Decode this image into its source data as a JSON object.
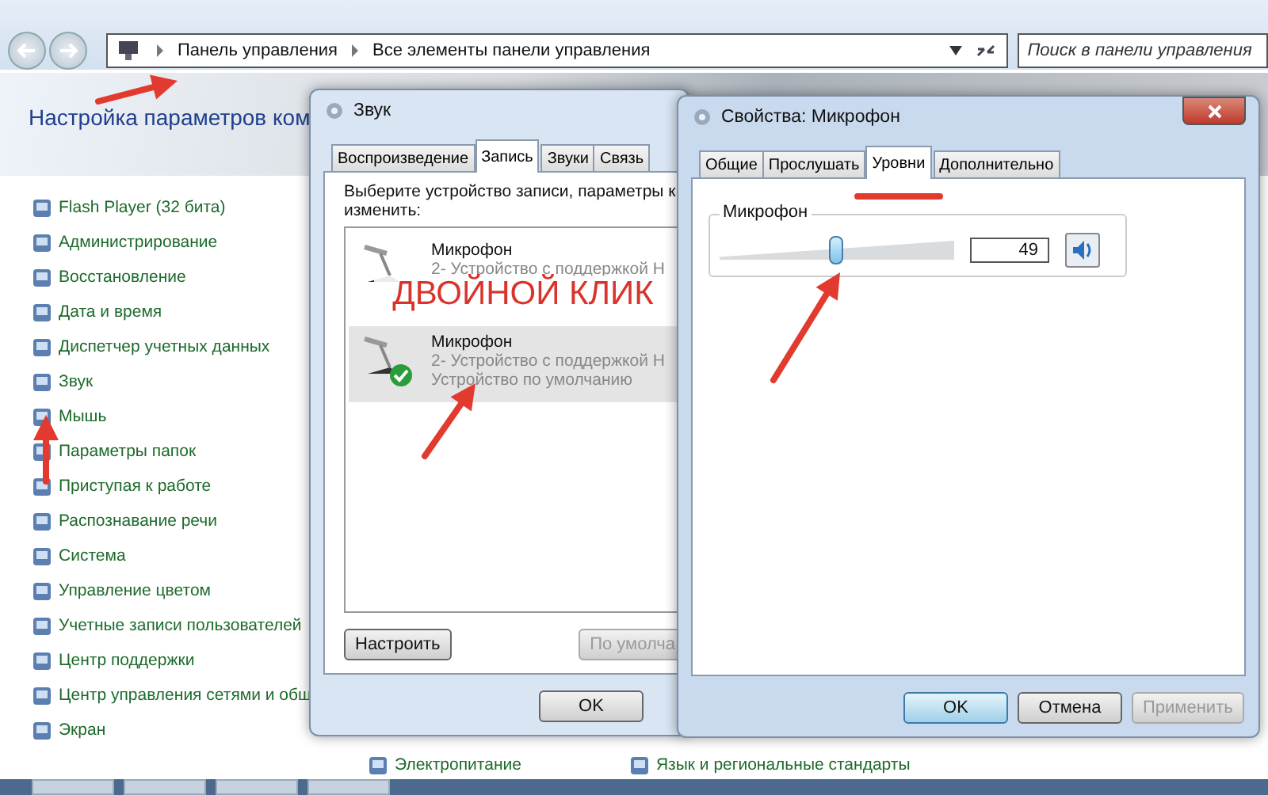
{
  "explorer": {
    "nav_path": [
      "Панель управления",
      "Все элементы панели управления"
    ],
    "search": {
      "placeholder": "Поиск в панели управления"
    },
    "heading": "Настройка параметров ком",
    "items": [
      "Flash Player (32 бита)",
      "Администрирование",
      "Восстановление",
      "Дата и время",
      "Диспетчер учетных данных",
      "Звук",
      "Мышь",
      "Параметры папок",
      "Приступая к работе",
      "Распознавание речи",
      "Система",
      "Управление цветом",
      "Учетные записи пользователей",
      "Центр поддержки",
      "Центр управления сетями и общ",
      "Экран"
    ],
    "bottom_items": [
      "Электропитание",
      "Язык и региональные стандарты"
    ]
  },
  "sound_dialog": {
    "title": "Звук",
    "tabs": [
      {
        "label": "Воспроизведение",
        "selected": false
      },
      {
        "label": "Запись",
        "selected": true
      },
      {
        "label": "Звуки",
        "selected": false
      },
      {
        "label": "Связь",
        "selected": false
      }
    ],
    "instruction": [
      "Выберите устройство записи, параметры к",
      "изменить:"
    ],
    "devices": [
      {
        "name": "Микрофон",
        "details": [
          "2- Устройство с поддержкой Н"
        ],
        "selected": false,
        "default": false
      },
      {
        "name": "Микрофон",
        "details": [
          "2- Устройство с поддержкой Н",
          "Устройство по умолчанию"
        ],
        "selected": true,
        "default": true
      }
    ],
    "buttons": [
      {
        "label": "Настроить",
        "disabled": false
      },
      {
        "label": "По умолча",
        "disabled": true
      }
    ],
    "footer_buttons": [
      {
        "label": "OK",
        "disabled": false
      }
    ]
  },
  "properties_dialog": {
    "title": "Свойства: Микрофон",
    "tabs": [
      {
        "label": "Общие",
        "selected": false
      },
      {
        "label": "Прослушать",
        "selected": false
      },
      {
        "label": "Уровни",
        "selected": true
      },
      {
        "label": "Дополнительно",
        "selected": false
      }
    ],
    "levels": {
      "group": "Микрофон",
      "level": 0.49,
      "value": "49",
      "muted": false
    },
    "buttons": [
      {
        "label": "OK",
        "default": true,
        "disabled": false
      },
      {
        "label": "Отмена",
        "default": false,
        "disabled": false
      },
      {
        "label": "Применить",
        "default": false,
        "disabled": true
      }
    ]
  },
  "annotations": {
    "callout": "ДВОЙНОЙ КЛИК"
  }
}
